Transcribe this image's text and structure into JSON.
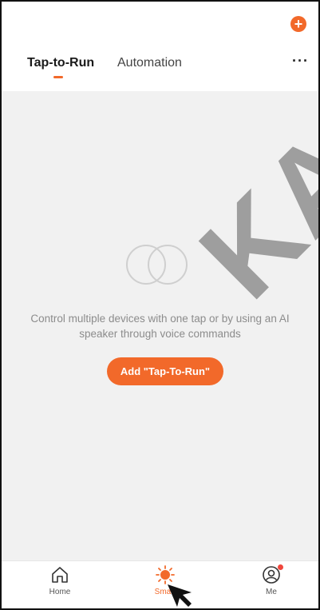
{
  "header": {
    "tabs": [
      {
        "label": "Tap-to-Run",
        "active": true
      },
      {
        "label": "Automation",
        "active": false
      }
    ],
    "add_icon": "plus-circle-icon",
    "more_icon": "more-horizontal-icon",
    "more_label": "···"
  },
  "empty_state": {
    "icon": "two-rings-icon",
    "message": "Control multiple devices with one tap or by using an AI speaker through voice commands",
    "button_label": "Add \"Tap-To-Run\""
  },
  "watermark": {
    "text": "KAPI"
  },
  "bottom_nav": {
    "items": [
      {
        "label": "Home",
        "icon": "home-icon",
        "active": false
      },
      {
        "label": "Smart",
        "icon": "sun-icon",
        "active": true
      },
      {
        "label": "Me",
        "icon": "user-icon",
        "active": false,
        "badge": true
      }
    ]
  },
  "colors": {
    "accent": "#f2692a",
    "content_background": "#f1f1f1",
    "muted_text": "#8c8c8c",
    "badge": "#f0463c"
  }
}
